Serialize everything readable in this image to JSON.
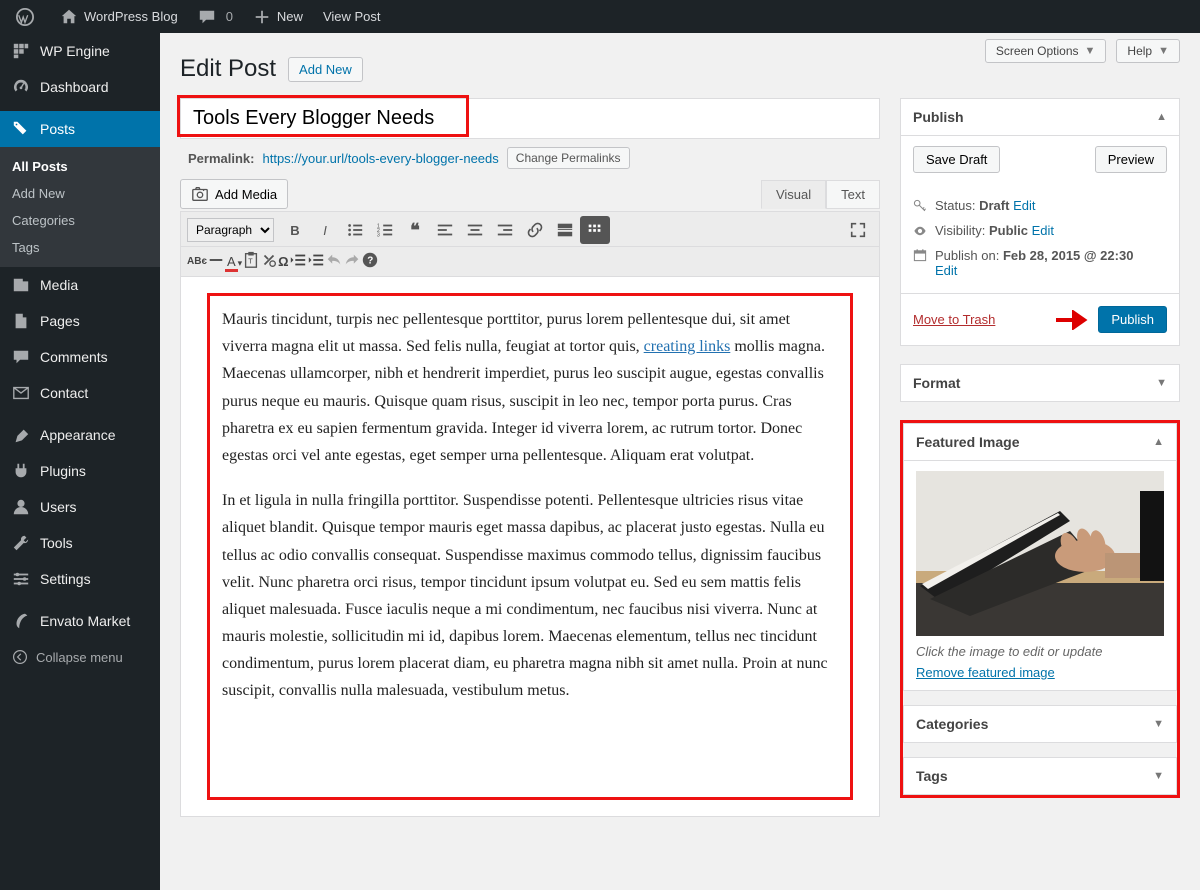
{
  "adminbar": {
    "site_name": "WordPress Blog",
    "comments_count": "0",
    "new_label": "New",
    "view_post": "View Post"
  },
  "top_links": {
    "screen_options": "Screen Options",
    "help": "Help"
  },
  "heading": {
    "title": "Edit Post",
    "add_new": "Add New"
  },
  "adminmenu": {
    "wp_engine": "WP Engine",
    "dashboard": "Dashboard",
    "posts": "Posts",
    "posts_sub": {
      "all": "All Posts",
      "add_new": "Add New",
      "categories": "Categories",
      "tags": "Tags"
    },
    "media": "Media",
    "pages": "Pages",
    "comments": "Comments",
    "contact": "Contact",
    "appearance": "Appearance",
    "plugins": "Plugins",
    "users": "Users",
    "tools": "Tools",
    "settings": "Settings",
    "envato": "Envato Market",
    "collapse": "Collapse menu"
  },
  "post": {
    "title": "Tools Every Blogger Needs",
    "permalink_label": "Permalink:",
    "permalink_url": "https://your.url/tools-every-blogger-needs",
    "change_permalink": "Change Permalinks",
    "add_media": "Add Media",
    "tab_visual": "Visual",
    "tab_text": "Text",
    "format_dropdown": "Paragraph",
    "body_p1_a": "Mauris tincidunt, turpis nec pellentesque porttitor, purus lorem pellentesque dui, sit amet viverra magna elit ut massa. Sed felis nulla, feugiat at tortor quis, ",
    "body_link": "creating links",
    "body_p1_b": " mollis magna. Maecenas ullamcorper, nibh et hendrerit imperdiet, purus leo suscipit augue, egestas convallis purus neque eu mauris. Quisque quam risus, suscipit in leo nec, tempor porta purus. Cras pharetra ex eu sapien fermentum gravida. Integer id viverra lorem, ac rutrum tortor. Donec egestas orci vel ante egestas, eget semper urna pellentesque. Aliquam erat volutpat.",
    "body_p2": "In et ligula in nulla fringilla porttitor. Suspendisse potenti. Pellentesque ultricies risus vitae aliquet blandit. Quisque tempor mauris eget massa dapibus, ac placerat justo egestas. Nulla eu tellus ac odio convallis consequat. Suspendisse maximus commodo tellus, dignissim faucibus velit. Nunc pharetra orci risus, tempor tincidunt ipsum volutpat eu. Sed eu sem mattis felis aliquet malesuada. Fusce iaculis neque a mi condimentum, nec faucibus nisi viverra. Nunc at mauris molestie, sollicitudin mi id, dapibus lorem. Maecenas elementum, tellus nec tincidunt condimentum, purus lorem placerat diam, eu pharetra magna nibh sit amet nulla. Proin at nunc suscipit, convallis nulla malesuada, vestibulum metus."
  },
  "publish": {
    "title": "Publish",
    "save_draft": "Save Draft",
    "preview": "Preview",
    "status_label": "Status:",
    "status_value": "Draft",
    "visibility_label": "Visibility:",
    "visibility_value": "Public",
    "schedule_label": "Publish on:",
    "schedule_value": "Feb 28, 2015 @ 22:30",
    "edit": "Edit",
    "trash": "Move to Trash",
    "publish_btn": "Publish"
  },
  "boxes": {
    "format": "Format",
    "featured": "Featured Image",
    "featured_caption": "Click the image to edit or update",
    "featured_remove": "Remove featured image",
    "categories": "Categories",
    "tags": "Tags"
  }
}
